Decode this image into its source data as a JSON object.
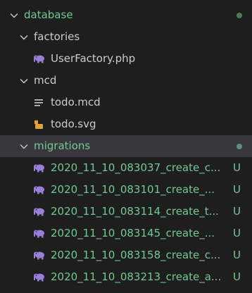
{
  "colors": {
    "background": "#1e1e1e",
    "selected_row": "#37373d",
    "untracked_text": "#73c991",
    "default_text": "#cccccc",
    "php_icon": "#9a7fd8",
    "svg_icon": "#e0a33a"
  },
  "explorer": {
    "database": {
      "label": "database",
      "icon": "chevron-down-icon"
    },
    "factories": {
      "label": "factories",
      "icon": "chevron-down-icon"
    },
    "user_factory": {
      "label": "UserFactory.php",
      "icon": "php-elephant-icon"
    },
    "mcd": {
      "label": "mcd",
      "icon": "chevron-down-icon"
    },
    "todo_mcd": {
      "label": "todo.mcd",
      "icon": "text-lines-icon"
    },
    "todo_svg": {
      "label": "todo.svg",
      "icon": "svg-file-icon"
    },
    "migrations": {
      "label": "migrations",
      "icon": "chevron-down-icon"
    },
    "migration_files": [
      {
        "label": "2020_11_10_083037_create_c...",
        "status": "U"
      },
      {
        "label": "2020_11_10_083101_create_...",
        "status": "U"
      },
      {
        "label": "2020_11_10_083114_create_t...",
        "status": "U"
      },
      {
        "label": "2020_11_10_083145_create_...",
        "status": "U"
      },
      {
        "label": "2020_11_10_083158_create_c...",
        "status": "U"
      },
      {
        "label": "2020_11_10_083213_create_a...",
        "status": "U"
      }
    ]
  }
}
